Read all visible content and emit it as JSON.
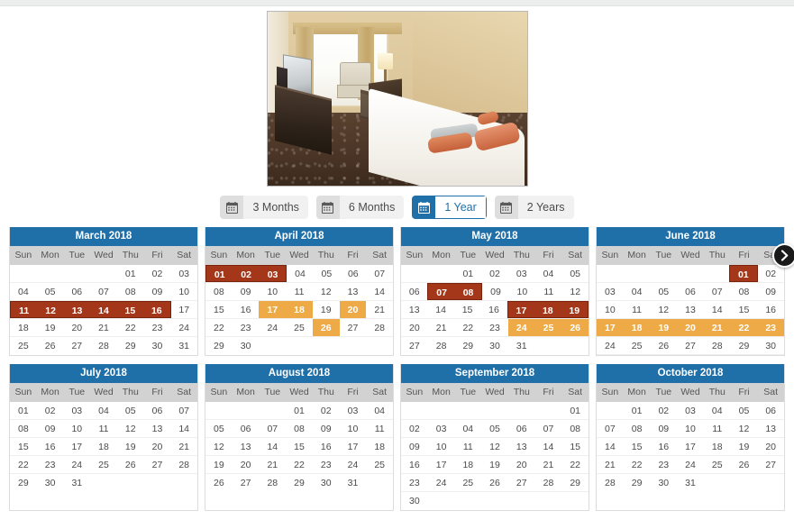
{
  "photo": {
    "alt": "hotel-room-photo",
    "caption": "Hotel twin room with window, television, armchair and bed"
  },
  "duration_tabs": {
    "icon": "calendar-icon",
    "items": [
      {
        "label": "3 Months",
        "active": false
      },
      {
        "label": "6 Months",
        "active": false
      },
      {
        "label": "1 Year",
        "active": true
      },
      {
        "label": "2 Years",
        "active": false
      }
    ]
  },
  "next_arrow": {
    "icon": "chevron-right-icon",
    "label": "›"
  },
  "legend_colors": {
    "header_blue": "#1f6fa9",
    "selected_red": "#a43719",
    "selected_red_border": "#7a230c",
    "selected_orange": "#eeaa46",
    "dow_gray": "#d2d2d2",
    "page_white": "#ffffff"
  },
  "weekday_headers": [
    "Sun",
    "Mon",
    "Tue",
    "Wed",
    "Thu",
    "Fri",
    "Sat"
  ],
  "calendar_rows": [
    [
      {
        "title": "March 2018",
        "weeks": [
          [
            {
              "d": ""
            },
            {
              "d": ""
            },
            {
              "d": ""
            },
            {
              "d": ""
            },
            {
              "d": "01"
            },
            {
              "d": "02"
            },
            {
              "d": "03"
            }
          ],
          [
            {
              "d": "04"
            },
            {
              "d": "05"
            },
            {
              "d": "06"
            },
            {
              "d": "07"
            },
            {
              "d": "08"
            },
            {
              "d": "09"
            },
            {
              "d": "10"
            }
          ],
          [
            {
              "d": "11",
              "s": "red",
              "e": "l"
            },
            {
              "d": "12",
              "s": "red"
            },
            {
              "d": "13",
              "s": "red"
            },
            {
              "d": "14",
              "s": "red"
            },
            {
              "d": "15",
              "s": "red"
            },
            {
              "d": "16",
              "s": "red",
              "e": "r"
            },
            {
              "d": "17"
            }
          ],
          [
            {
              "d": "18"
            },
            {
              "d": "19"
            },
            {
              "d": "20"
            },
            {
              "d": "21"
            },
            {
              "d": "22"
            },
            {
              "d": "23"
            },
            {
              "d": "24"
            }
          ],
          [
            {
              "d": "25"
            },
            {
              "d": "26"
            },
            {
              "d": "27"
            },
            {
              "d": "28"
            },
            {
              "d": "29"
            },
            {
              "d": "30"
            },
            {
              "d": "31"
            }
          ]
        ]
      },
      {
        "title": "April 2018",
        "weeks": [
          [
            {
              "d": "01",
              "s": "red",
              "e": "l"
            },
            {
              "d": "02",
              "s": "red"
            },
            {
              "d": "03",
              "s": "red",
              "e": "r"
            },
            {
              "d": "04"
            },
            {
              "d": "05"
            },
            {
              "d": "06"
            },
            {
              "d": "07"
            }
          ],
          [
            {
              "d": "08"
            },
            {
              "d": "09"
            },
            {
              "d": "10"
            },
            {
              "d": "11"
            },
            {
              "d": "12"
            },
            {
              "d": "13"
            },
            {
              "d": "14"
            }
          ],
          [
            {
              "d": "15"
            },
            {
              "d": "16"
            },
            {
              "d": "17",
              "s": "orange"
            },
            {
              "d": "18",
              "s": "orange"
            },
            {
              "d": "19"
            },
            {
              "d": "20",
              "s": "orange"
            },
            {
              "d": "21"
            }
          ],
          [
            {
              "d": "22"
            },
            {
              "d": "23"
            },
            {
              "d": "24"
            },
            {
              "d": "25"
            },
            {
              "d": "26",
              "s": "orange"
            },
            {
              "d": "27"
            },
            {
              "d": "28"
            }
          ],
          [
            {
              "d": "29"
            },
            {
              "d": "30"
            },
            {
              "d": ""
            },
            {
              "d": ""
            },
            {
              "d": ""
            },
            {
              "d": ""
            },
            {
              "d": ""
            }
          ]
        ]
      },
      {
        "title": "May 2018",
        "weeks": [
          [
            {
              "d": ""
            },
            {
              "d": ""
            },
            {
              "d": "01"
            },
            {
              "d": "02"
            },
            {
              "d": "03"
            },
            {
              "d": "04"
            },
            {
              "d": "05"
            }
          ],
          [
            {
              "d": "06"
            },
            {
              "d": "07",
              "s": "red",
              "e": "l"
            },
            {
              "d": "08",
              "s": "red",
              "e": "r"
            },
            {
              "d": "09"
            },
            {
              "d": "10"
            },
            {
              "d": "11"
            },
            {
              "d": "12"
            }
          ],
          [
            {
              "d": "13"
            },
            {
              "d": "14"
            },
            {
              "d": "15"
            },
            {
              "d": "16"
            },
            {
              "d": "17",
              "s": "red",
              "e": "l"
            },
            {
              "d": "18",
              "s": "red"
            },
            {
              "d": "19",
              "s": "red",
              "e": "r"
            }
          ],
          [
            {
              "d": "20"
            },
            {
              "d": "21"
            },
            {
              "d": "22"
            },
            {
              "d": "23"
            },
            {
              "d": "24",
              "s": "orange"
            },
            {
              "d": "25",
              "s": "orange"
            },
            {
              "d": "26",
              "s": "orange"
            }
          ],
          [
            {
              "d": "27"
            },
            {
              "d": "28"
            },
            {
              "d": "29"
            },
            {
              "d": "30"
            },
            {
              "d": "31"
            },
            {
              "d": ""
            },
            {
              "d": ""
            }
          ]
        ]
      },
      {
        "title": "June 2018",
        "has_next_arrow": true,
        "weeks": [
          [
            {
              "d": ""
            },
            {
              "d": ""
            },
            {
              "d": ""
            },
            {
              "d": ""
            },
            {
              "d": ""
            },
            {
              "d": "01",
              "s": "red",
              "e": "lr"
            },
            {
              "d": "02"
            }
          ],
          [
            {
              "d": "03"
            },
            {
              "d": "04"
            },
            {
              "d": "05"
            },
            {
              "d": "06"
            },
            {
              "d": "07"
            },
            {
              "d": "08"
            },
            {
              "d": "09"
            }
          ],
          [
            {
              "d": "10"
            },
            {
              "d": "11"
            },
            {
              "d": "12"
            },
            {
              "d": "13"
            },
            {
              "d": "14"
            },
            {
              "d": "15"
            },
            {
              "d": "16"
            }
          ],
          [
            {
              "d": "17",
              "s": "orange"
            },
            {
              "d": "18",
              "s": "orange"
            },
            {
              "d": "19",
              "s": "orange"
            },
            {
              "d": "20",
              "s": "orange"
            },
            {
              "d": "21",
              "s": "orange"
            },
            {
              "d": "22",
              "s": "orange"
            },
            {
              "d": "23",
              "s": "orange"
            }
          ],
          [
            {
              "d": "24"
            },
            {
              "d": "25"
            },
            {
              "d": "26"
            },
            {
              "d": "27"
            },
            {
              "d": "28"
            },
            {
              "d": "29"
            },
            {
              "d": "30"
            }
          ]
        ]
      }
    ],
    [
      {
        "title": "July 2018",
        "weeks": [
          [
            {
              "d": "01"
            },
            {
              "d": "02"
            },
            {
              "d": "03"
            },
            {
              "d": "04"
            },
            {
              "d": "05"
            },
            {
              "d": "06"
            },
            {
              "d": "07"
            }
          ],
          [
            {
              "d": "08"
            },
            {
              "d": "09"
            },
            {
              "d": "10"
            },
            {
              "d": "11"
            },
            {
              "d": "12"
            },
            {
              "d": "13"
            },
            {
              "d": "14"
            }
          ],
          [
            {
              "d": "15"
            },
            {
              "d": "16"
            },
            {
              "d": "17"
            },
            {
              "d": "18"
            },
            {
              "d": "19"
            },
            {
              "d": "20"
            },
            {
              "d": "21"
            }
          ],
          [
            {
              "d": "22"
            },
            {
              "d": "23"
            },
            {
              "d": "24"
            },
            {
              "d": "25"
            },
            {
              "d": "26"
            },
            {
              "d": "27"
            },
            {
              "d": "28"
            }
          ],
          [
            {
              "d": "29"
            },
            {
              "d": "30"
            },
            {
              "d": "31"
            },
            {
              "d": ""
            },
            {
              "d": ""
            },
            {
              "d": ""
            },
            {
              "d": ""
            }
          ]
        ]
      },
      {
        "title": "August 2018",
        "weeks": [
          [
            {
              "d": ""
            },
            {
              "d": ""
            },
            {
              "d": ""
            },
            {
              "d": "01"
            },
            {
              "d": "02"
            },
            {
              "d": "03"
            },
            {
              "d": "04"
            }
          ],
          [
            {
              "d": "05"
            },
            {
              "d": "06"
            },
            {
              "d": "07"
            },
            {
              "d": "08"
            },
            {
              "d": "09"
            },
            {
              "d": "10"
            },
            {
              "d": "11"
            }
          ],
          [
            {
              "d": "12"
            },
            {
              "d": "13"
            },
            {
              "d": "14"
            },
            {
              "d": "15"
            },
            {
              "d": "16"
            },
            {
              "d": "17"
            },
            {
              "d": "18"
            }
          ],
          [
            {
              "d": "19"
            },
            {
              "d": "20"
            },
            {
              "d": "21"
            },
            {
              "d": "22"
            },
            {
              "d": "23"
            },
            {
              "d": "24"
            },
            {
              "d": "25"
            }
          ],
          [
            {
              "d": "26"
            },
            {
              "d": "27"
            },
            {
              "d": "28"
            },
            {
              "d": "29"
            },
            {
              "d": "30"
            },
            {
              "d": "31"
            },
            {
              "d": ""
            }
          ]
        ]
      },
      {
        "title": "September 2018",
        "weeks": [
          [
            {
              "d": ""
            },
            {
              "d": ""
            },
            {
              "d": ""
            },
            {
              "d": ""
            },
            {
              "d": ""
            },
            {
              "d": ""
            },
            {
              "d": "01"
            }
          ],
          [
            {
              "d": "02"
            },
            {
              "d": "03"
            },
            {
              "d": "04"
            },
            {
              "d": "05"
            },
            {
              "d": "06"
            },
            {
              "d": "07"
            },
            {
              "d": "08"
            }
          ],
          [
            {
              "d": "09"
            },
            {
              "d": "10"
            },
            {
              "d": "11"
            },
            {
              "d": "12"
            },
            {
              "d": "13"
            },
            {
              "d": "14"
            },
            {
              "d": "15"
            }
          ],
          [
            {
              "d": "16"
            },
            {
              "d": "17"
            },
            {
              "d": "18"
            },
            {
              "d": "19"
            },
            {
              "d": "20"
            },
            {
              "d": "21"
            },
            {
              "d": "22"
            }
          ],
          [
            {
              "d": "23"
            },
            {
              "d": "24"
            },
            {
              "d": "25"
            },
            {
              "d": "26"
            },
            {
              "d": "27"
            },
            {
              "d": "28"
            },
            {
              "d": "29"
            }
          ],
          [
            {
              "d": "30"
            },
            {
              "d": ""
            },
            {
              "d": ""
            },
            {
              "d": ""
            },
            {
              "d": ""
            },
            {
              "d": ""
            },
            {
              "d": ""
            }
          ]
        ]
      },
      {
        "title": "October 2018",
        "weeks": [
          [
            {
              "d": ""
            },
            {
              "d": "01"
            },
            {
              "d": "02"
            },
            {
              "d": "03"
            },
            {
              "d": "04"
            },
            {
              "d": "05"
            },
            {
              "d": "06"
            }
          ],
          [
            {
              "d": "07"
            },
            {
              "d": "08"
            },
            {
              "d": "09"
            },
            {
              "d": "10"
            },
            {
              "d": "11"
            },
            {
              "d": "12"
            },
            {
              "d": "13"
            }
          ],
          [
            {
              "d": "14"
            },
            {
              "d": "15"
            },
            {
              "d": "16"
            },
            {
              "d": "17"
            },
            {
              "d": "18"
            },
            {
              "d": "19"
            },
            {
              "d": "20"
            }
          ],
          [
            {
              "d": "21"
            },
            {
              "d": "22"
            },
            {
              "d": "23"
            },
            {
              "d": "24"
            },
            {
              "d": "25"
            },
            {
              "d": "26"
            },
            {
              "d": "27"
            }
          ],
          [
            {
              "d": "28"
            },
            {
              "d": "29"
            },
            {
              "d": "30"
            },
            {
              "d": "31"
            },
            {
              "d": ""
            },
            {
              "d": ""
            },
            {
              "d": ""
            }
          ]
        ]
      }
    ]
  ]
}
